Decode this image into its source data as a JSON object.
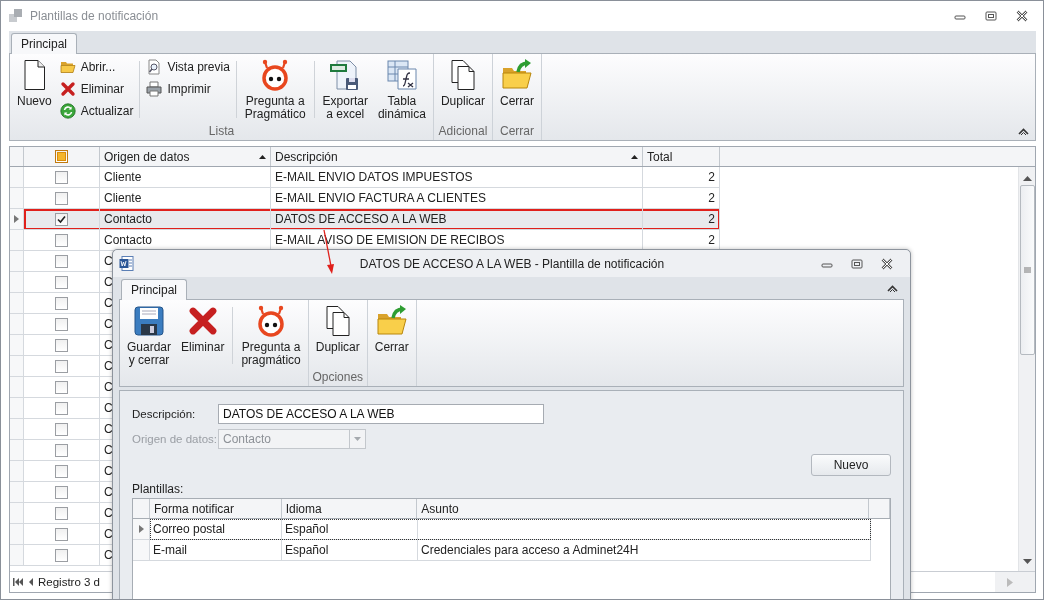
{
  "window": {
    "title": "Plantillas de notificación"
  },
  "ribbon": {
    "tabs": [
      {
        "label": "Principal",
        "selected": true
      }
    ],
    "groups": [
      {
        "label": "Lista",
        "columns": [
          {
            "separated": false,
            "items": [
              "Nuevo"
            ]
          },
          {
            "separated": false,
            "items": [
              "Abrir...",
              "Eliminar",
              "Actualizar"
            ]
          },
          {
            "separated": true,
            "items": [
              "Vista previa",
              "Imprimir"
            ]
          },
          {
            "separated": true,
            "items": [
              "Pregunta a\nPragmático"
            ]
          },
          {
            "separated": true,
            "items": [
              "Exportar\na excel"
            ]
          },
          {
            "separated": false,
            "items": [
              "Tabla\ndinámica"
            ]
          }
        ]
      },
      {
        "label": "Adicional",
        "columns": [
          {
            "separated": false,
            "items": [
              "Duplicar"
            ]
          }
        ]
      },
      {
        "label": "Cerrar",
        "columns": [
          {
            "separated": false,
            "items": [
              "Cerrar"
            ]
          }
        ]
      }
    ]
  },
  "table": {
    "select_all": {
      "indeterminate": true
    },
    "columns": [
      {
        "label": "Origen de datos",
        "sorted": true
      },
      {
        "label": "Descripción",
        "sorted": true
      },
      {
        "label": "Total",
        "sorted": false
      }
    ],
    "rows": [
      {
        "origin": "Cliente",
        "description": "E-MAIL ENVIO DATOS IMPUESTOS",
        "total": "2",
        "checked": false,
        "selected": false
      },
      {
        "origin": "Cliente",
        "description": "E-MAIL ENVIO FACTURA A CLIENTES",
        "total": "2",
        "checked": false,
        "selected": false
      },
      {
        "origin": "Contacto",
        "description": "DATOS DE ACCESO A LA WEB",
        "total": "2",
        "checked": true,
        "selected": true
      },
      {
        "origin": "Contacto",
        "description": "E-MAIL AVISO DE EMISION DE RECIBOS",
        "total": "2",
        "checked": false,
        "selected": false
      },
      {
        "origin": "C",
        "checked": false,
        "selected": false
      },
      {
        "origin": "C",
        "checked": false,
        "selected": false
      },
      {
        "origin": "C",
        "checked": false,
        "selected": false
      },
      {
        "origin": "C",
        "checked": false,
        "selected": false
      },
      {
        "origin": "C",
        "checked": false,
        "selected": false
      },
      {
        "origin": "C",
        "checked": false,
        "selected": false
      },
      {
        "origin": "C",
        "checked": false,
        "selected": false
      },
      {
        "origin": "C",
        "checked": false,
        "selected": false
      },
      {
        "origin": "C",
        "checked": false,
        "selected": false
      },
      {
        "origin": "C",
        "checked": false,
        "selected": false
      },
      {
        "origin": "C",
        "checked": false,
        "selected": false
      },
      {
        "origin": "C",
        "checked": false,
        "selected": false
      },
      {
        "origin": "C",
        "checked": false,
        "selected": false
      },
      {
        "origin": "C",
        "checked": false,
        "selected": false
      },
      {
        "origin": "C",
        "checked": false,
        "selected": false
      }
    ]
  },
  "status_bar": {
    "record": "Registro 3 d"
  },
  "dialog": {
    "title": "DATOS DE ACCESO A LA WEB - Plantilla de notificación",
    "ribbon": {
      "tabs": [
        {
          "label": "Principal",
          "selected": true
        }
      ],
      "groups": [
        {
          "columns": [
            {
              "separated": false,
              "items": [
                "Guardar\ny cerrar"
              ]
            },
            {
              "separated": false,
              "items": [
                "Eliminar"
              ]
            },
            {
              "separated": true,
              "items": [
                "Pregunta a\npragmático"
              ]
            }
          ]
        },
        {
          "label": "Opciones",
          "columns": [
            {
              "separated": false,
              "items": [
                "Duplicar"
              ]
            }
          ]
        },
        {
          "columns": [
            {
              "separated": false,
              "items": [
                "Cerrar"
              ]
            }
          ]
        }
      ]
    },
    "form": {
      "description": {
        "label": "Descripción:",
        "value": "DATOS DE ACCESO A LA WEB"
      },
      "origin": {
        "label": "Origen de datos:",
        "value": "Contacto",
        "disabled": true
      },
      "new_button": "Nuevo",
      "templates_label": "Plantillas:",
      "templates": {
        "columns": [
          "Forma notificar",
          "Idioma",
          "Asunto"
        ],
        "rows": [
          {
            "cells": [
              "Correo postal",
              "Español",
              ""
            ],
            "selected": true
          },
          {
            "cells": [
              "E-mail",
              "Español",
              "Credenciales para acceso a Adminet24H"
            ],
            "selected": false
          }
        ]
      }
    }
  }
}
